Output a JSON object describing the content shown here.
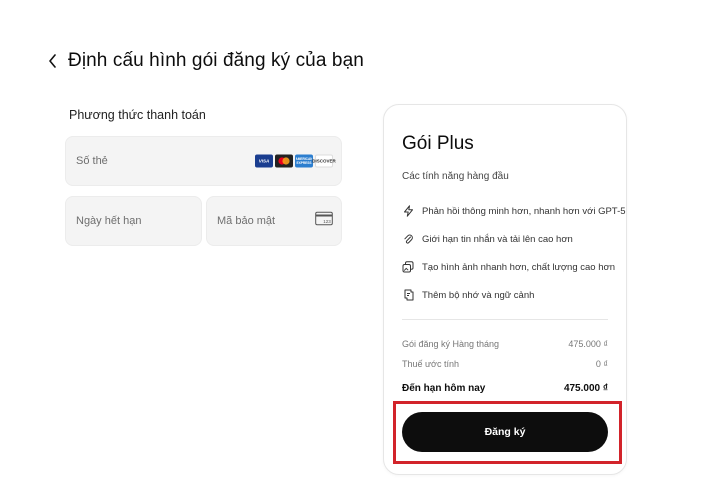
{
  "header": {
    "title": "Định cấu hình gói đăng ký của bạn"
  },
  "payment": {
    "section_label": "Phương thức thanh toán",
    "card_number_placeholder": "Số thẻ",
    "expiry_placeholder": "Ngày hết hạn",
    "cvc_placeholder": "Mã bảo mật",
    "brands": {
      "visa": "VISA",
      "amex": "AMERICAN EXPRESS",
      "discover": "DISCOVER",
      "cvc_icon_text": "123"
    }
  },
  "plan": {
    "name": "Gói Plus",
    "features_heading": "Các tính năng hàng đầu",
    "features": [
      {
        "icon": "lightning-icon",
        "label": "Phản hồi thông minh hơn, nhanh hơn với GPT-5"
      },
      {
        "icon": "paperclip-icon",
        "label": "Giới hạn tin nhắn và tải lên cao hơn"
      },
      {
        "icon": "images-icon",
        "label": "Tạo hình ảnh nhanh hơn, chất lượng cao hơn"
      },
      {
        "icon": "memory-icon",
        "label": "Thêm bộ nhớ và ngữ cảnh"
      }
    ],
    "pricing": {
      "monthly_label": "Gói đăng ký Hàng tháng",
      "monthly_value": "475.000 ₫",
      "tax_label": "Thuế ước tính",
      "tax_value": "0 ₫",
      "total_label": "Đến hạn hôm nay",
      "total_value": "475.000 ₫"
    },
    "subscribe_label": "Đăng ký"
  },
  "colors": {
    "highlight": "#d2232a",
    "button": "#0d0d0d",
    "field_bg": "#f4f4f4"
  }
}
